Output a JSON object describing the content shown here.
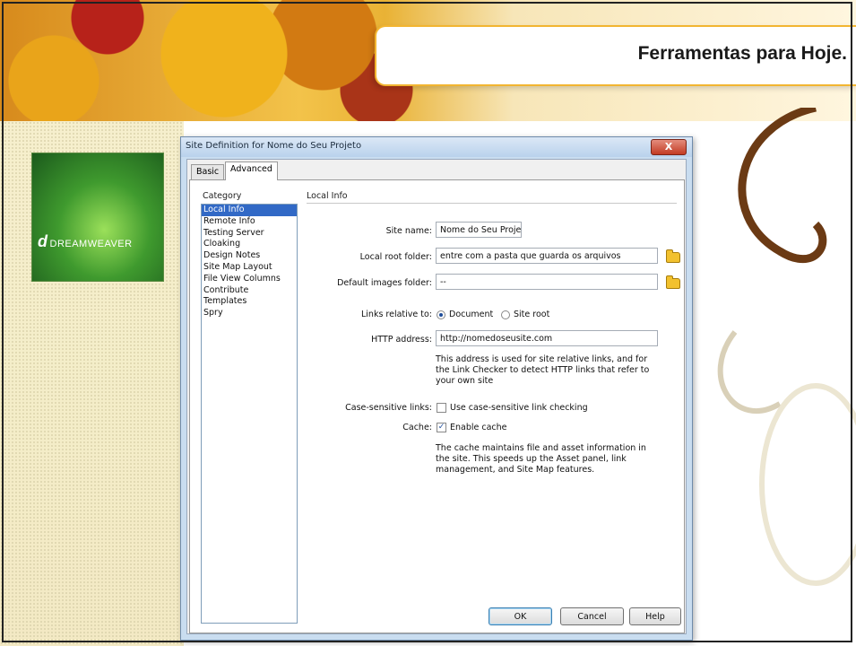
{
  "slide": {
    "title": "Ferramentas para Hoje."
  },
  "logo": {
    "text": "DREAMWEAVER"
  },
  "dialog": {
    "title": "Site Definition for Nome do Seu Projeto",
    "close_label": "X",
    "tabs": [
      "Basic",
      "Advanced"
    ],
    "active_tab": "Advanced",
    "category_label": "Category",
    "categories": [
      "Local Info",
      "Remote Info",
      "Testing Server",
      "Cloaking",
      "Design Notes",
      "Site Map Layout",
      "File View Columns",
      "Contribute",
      "Templates",
      "Spry"
    ],
    "selected_category": "Local Info",
    "section_label": "Local Info",
    "fields": {
      "site_name_label": "Site name:",
      "site_name_value": "Nome do Seu Projet",
      "local_root_label": "Local root folder:",
      "local_root_value": "entre com a pasta que guarda os arquivos",
      "images_label": "Default images folder:",
      "images_value": "--",
      "links_label": "Links relative to:",
      "links_option_document": "Document",
      "links_option_siteroot": "Site root",
      "links_selected": "Document",
      "http_label": "HTTP address:",
      "http_value": "http://nomedoseusite.com",
      "http_note_lines": [
        "This address is used for site relative links, and for",
        "the Link Checker to detect HTTP links that refer to",
        "your own site"
      ],
      "case_label": "Case-sensitive links:",
      "case_option": "Use case-sensitive link checking",
      "case_checked": false,
      "cache_label": "Cache:",
      "cache_option": "Enable cache",
      "cache_checked": true,
      "cache_note_lines": [
        "The cache maintains file and asset information in",
        "the site.  This speeds up the Asset panel, link",
        "management, and Site Map features."
      ]
    },
    "buttons": {
      "ok": "OK",
      "cancel": "Cancel",
      "help": "Help"
    }
  },
  "colors": {
    "accent_orange": "#f2b531",
    "selection_blue": "#3169c6",
    "dialog_frame": "#c9ddf0",
    "logo_green": "#3f9a2e"
  }
}
